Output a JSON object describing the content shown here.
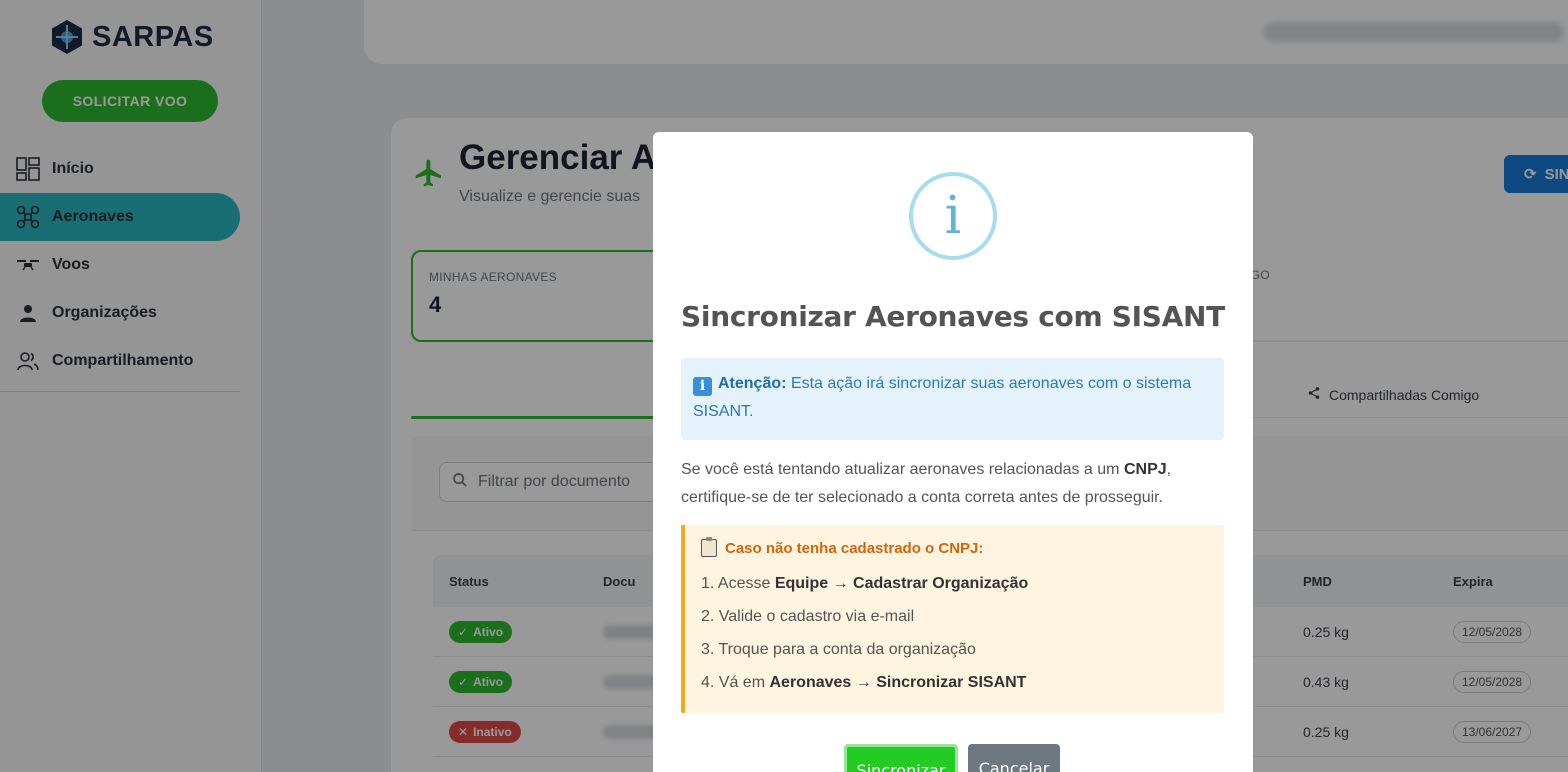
{
  "app": {
    "name": "SARPAS"
  },
  "sidebar": {
    "cta_label": "SOLICITAR VOO",
    "items": [
      {
        "label": "Início",
        "icon": "dashboard-icon",
        "active": false
      },
      {
        "label": "Aeronaves",
        "icon": "drone-icon",
        "active": true
      },
      {
        "label": "Voos",
        "icon": "flight-drone-icon",
        "active": false
      },
      {
        "label": "Organizações",
        "icon": "person-icon",
        "active": false
      },
      {
        "label": "Compartilhamento",
        "icon": "people-icon",
        "active": false
      }
    ]
  },
  "page": {
    "title": "Gerenciar A",
    "subtitle": "Visualize e gerencie suas",
    "sync_button_label": "SIN",
    "stats": [
      {
        "label": "MINHAS AERONAVES",
        "value": "4"
      },
      {
        "label": "IGO",
        "value": ""
      }
    ],
    "tabs": {
      "shared_label": "Compartilhadas Comigo"
    },
    "filter_placeholder": "Filtrar por documento",
    "table": {
      "headers": {
        "status": "Status",
        "doc": "Docu",
        "pmd": "PMD",
        "expira": "Expira"
      },
      "rows": [
        {
          "status": "Ativo",
          "active": true,
          "pmd": "0.25 kg",
          "expira": "12/05/2028"
        },
        {
          "status": "Ativo",
          "active": true,
          "pmd": "0.43 kg",
          "expira": "12/05/2028"
        },
        {
          "status": "Inativo",
          "active": false,
          "pmd": "0.25 kg",
          "expira": "13/06/2027"
        }
      ]
    }
  },
  "modal": {
    "title": "Sincronizar Aeronaves com SISANT",
    "info_label": "Atenção:",
    "info_text": "Esta ação irá sincronizar suas aeronaves com o sistema SISANT.",
    "para_before": "Se você está tentando atualizar aeronaves relacionadas a um ",
    "para_bold": "CNPJ",
    "para_after": ", certifique-se de ter selecionado a conta correta antes de prosseguir.",
    "warn_title": "Caso não tenha cadastrado o CNPJ:",
    "steps": {
      "s1_prefix": "1. Acesse ",
      "s1_bold": "Equipe → Cadastrar Organização",
      "s2": "2. Valide o cadastro via e-mail",
      "s3": "3. Troque para a conta da organização",
      "s4_prefix": "4. Vá em ",
      "s4_bold": "Aeronaves → Sincronizar SISANT"
    },
    "confirm_label": "Sincronizar",
    "cancel_label": "Cancelar"
  },
  "colors": {
    "brand_green": "#2eb82e",
    "active_nav": "#2ab7c2",
    "primary_blue": "#1a7ad9",
    "warn_orange": "#f5a623"
  }
}
